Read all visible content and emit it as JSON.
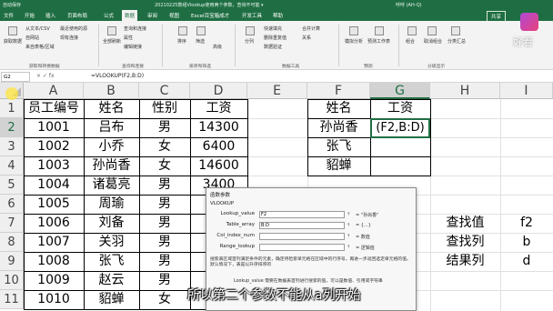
{
  "titlebar": {
    "autosave": "自动保存",
    "title": "20210225数组Vlookup使用两个参数，查询不可能 ▾",
    "user": "呼呼 (AH-Q)"
  },
  "menubar": {
    "tabs": [
      "文件",
      "开始",
      "插入",
      "页面布局",
      "公式",
      "数据",
      "审阅",
      "视图",
      "Excel百宝箱成才",
      "开发工具",
      "帮助"
    ],
    "active_tab": "数据",
    "share": "共享"
  },
  "ribbon": {
    "buttons": [
      "获取数据",
      "从文本/CSV",
      "自网站",
      "来自表格/区域",
      "最近使用的源",
      "现有连接",
      "全部刷新",
      "查询和连接",
      "属性",
      "编辑链接",
      "排序",
      "筛选",
      "高级",
      "分列",
      "快速填充",
      "删除重复值",
      "数据验证",
      "合并计算",
      "关系",
      "模拟分析",
      "预测工作表",
      "组合",
      "取消组合",
      "分类汇总"
    ],
    "groups": [
      "获取和转换数据",
      "查询和连接",
      "排序和筛选",
      "数据工具",
      "预测",
      "分级显示"
    ]
  },
  "logo": {
    "text": "好看"
  },
  "formula_bar": {
    "name_box": "G2",
    "icons": "×  ✓  fx",
    "formula": "=VLOOKUP(F2,B:D)"
  },
  "sheet": {
    "columns": [
      "A",
      "B",
      "C",
      "D",
      "E",
      "F",
      "G",
      "H",
      "I"
    ],
    "selected_column": "G",
    "rows": [
      "1",
      "2",
      "3",
      "4",
      "5",
      "6",
      "7",
      "8",
      "9",
      "10",
      "11"
    ],
    "selected_row": "2",
    "table_header": [
      "员工编号",
      "姓名",
      "性别",
      "工资"
    ],
    "table_rows": [
      [
        "1001",
        "吕布",
        "男",
        "14300"
      ],
      [
        "1002",
        "小乔",
        "女",
        "6400"
      ],
      [
        "1003",
        "孙尚香",
        "女",
        "14600"
      ],
      [
        "1004",
        "诸葛亮",
        "男",
        "3400"
      ],
      [
        "1005",
        "周瑜",
        "男",
        ""
      ],
      [
        "1006",
        "刘备",
        "男",
        ""
      ],
      [
        "1007",
        "关羽",
        "男",
        ""
      ],
      [
        "1008",
        "张飞",
        "男",
        ""
      ],
      [
        "1009",
        "赵云",
        "男",
        ""
      ],
      [
        "1010",
        "貂蝉",
        "女",
        ""
      ]
    ],
    "lookup_header": [
      "姓名",
      "工资"
    ],
    "lookup_rows": [
      [
        "孙尚香",
        "(F2,B:D)"
      ],
      [
        "张飞",
        ""
      ],
      [
        "貂蝉",
        ""
      ]
    ],
    "notes": [
      [
        "查找值",
        "f2"
      ],
      [
        "查找列",
        "b"
      ],
      [
        "结果列",
        "d"
      ]
    ]
  },
  "dialog": {
    "title": "函数参数",
    "function": "VLOOKUP",
    "args": [
      {
        "label": "Lookup_value",
        "value": "F2",
        "result": "= \"孙尚香\""
      },
      {
        "label": "Table_array",
        "value": "B:D",
        "result": "= {...}"
      },
      {
        "label": "Col_index_num",
        "value": "",
        "result": "= 数值"
      },
      {
        "label": "Range_lookup",
        "value": "",
        "result": "= 逻辑值"
      }
    ],
    "description": "搜索表区域首列满足条件的元素，确定待检索单元格在区域中的行序号，再进一步返回选定单元格的值。默认情况下，表是以升序排序的",
    "arg_description": "Lookup_value  需要在数据表首列进行搜索的值，可以是数值、引用或字符串"
  },
  "subtitle": "所以第二个参数不能从a列开始"
}
